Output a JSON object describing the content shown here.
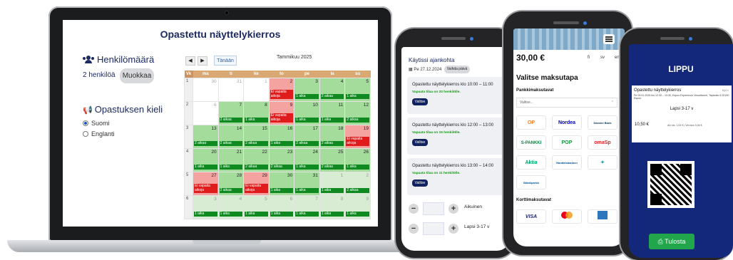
{
  "laptop": {
    "title": "Opastettu näyttelykierros",
    "persons_label": "Henkilömäärä",
    "persons_value": "2 henkilöä",
    "edit_button": "Muokkaa",
    "language_label": "Opastuksen kieli",
    "lang_fi": "Suomi",
    "lang_en": "Englanti",
    "nav_prev": "◀",
    "nav_next": "▶",
    "today_button": "Tänään",
    "month": "Tammikuu 2025",
    "weekdays": [
      "Vk",
      "ma",
      "ti",
      "ke",
      "to",
      "pe",
      "la",
      "su"
    ],
    "slot_ok": "1 aika",
    "slot_ok2": "2 aikaa",
    "slot_full": "Ei vapaita aikoja"
  },
  "calendar_rows": [
    {
      "week": "1",
      "days": [
        [
          "30",
          "w",
          ""
        ],
        [
          "31",
          "w",
          ""
        ],
        [
          "1",
          "w",
          ""
        ],
        [
          "2",
          "r",
          "full"
        ],
        [
          "3",
          "g",
          "1 aika"
        ],
        [
          "4",
          "g",
          "2 aikaa"
        ],
        [
          "5",
          "g",
          "1 aika"
        ]
      ]
    },
    {
      "week": "2",
      "days": [
        [
          "6",
          "w",
          ""
        ],
        [
          "7",
          "g",
          "2 aikaa"
        ],
        [
          "8",
          "g",
          "1 aika"
        ],
        [
          "9",
          "r",
          "full"
        ],
        [
          "10",
          "g",
          "1 aika"
        ],
        [
          "11",
          "g",
          "1 aika"
        ],
        [
          "12",
          "g",
          "2 aikaa"
        ]
      ]
    },
    {
      "week": "3",
      "days": [
        [
          "13",
          "g",
          "2 aikaa"
        ],
        [
          "14",
          "g",
          "2 aikaa"
        ],
        [
          "15",
          "g",
          "2 aikaa"
        ],
        [
          "16",
          "g",
          "1 aika"
        ],
        [
          "17",
          "g",
          "2 aikaa"
        ],
        [
          "18",
          "g",
          "2 aikaa"
        ],
        [
          "19",
          "r",
          "full"
        ]
      ]
    },
    {
      "week": "4",
      "days": [
        [
          "20",
          "g",
          "1 aika"
        ],
        [
          "21",
          "g",
          "1 aika"
        ],
        [
          "22",
          "g",
          "2 aikaa"
        ],
        [
          "23",
          "g",
          "2 aikaa"
        ],
        [
          "24",
          "g",
          "1 aika"
        ],
        [
          "25",
          "g",
          "2 aikaa"
        ],
        [
          "26",
          "g",
          "1 aika"
        ]
      ]
    },
    {
      "week": "5",
      "days": [
        [
          "27",
          "r",
          "full"
        ],
        [
          "28",
          "g",
          "2 aikaa"
        ],
        [
          "29",
          "r",
          "full"
        ],
        [
          "30",
          "g",
          "1 aika"
        ],
        [
          "31",
          "g",
          "1 aika"
        ],
        [
          "1",
          "pg",
          "1 aika"
        ],
        [
          "2",
          "pg",
          "2 aikaa"
        ]
      ]
    },
    {
      "week": "6",
      "days": [
        [
          "3",
          "pg",
          "1 aika"
        ],
        [
          "4",
          "pg",
          "1 aika"
        ],
        [
          "5",
          "pg",
          "1 aika"
        ],
        [
          "6",
          "pg",
          "1 aika"
        ],
        [
          "7",
          "pg",
          "1 aika"
        ],
        [
          "8",
          "pg",
          "1 aika"
        ],
        [
          "9",
          "pg",
          "1 aika"
        ]
      ]
    }
  ],
  "phone1": {
    "header": "Käytissi ajankohta",
    "date": "Pe 27.12.2024",
    "change": "Vaihda päivä",
    "cards": [
      {
        "title": "Opastettu näyttelykierros klo 10:00 – 11:00",
        "avail": "Vapaata tilaa on 20 henkilölle.",
        "btn": "Valitse"
      },
      {
        "title": "Opastettu näyttelykierros klo 12:00 – 13:00",
        "avail": "Vapaata tilaa on 15 henkilölle.",
        "btn": "Valitse"
      },
      {
        "title": "Opastettu näyttelykierros klo 13:00 – 14:00",
        "avail": "Vapaata tilaa on 11 henkilölle.",
        "btn": "Valitse"
      }
    ],
    "adult": "Aikuinen",
    "child": "Lapsi 3-17 v",
    "minus": "−",
    "plus": "+"
  },
  "phone2": {
    "price": "30,00 €",
    "lang_fi": "fi",
    "lang_sv": "sv",
    "lang_en": "en",
    "heading": "Valitse maksutapa",
    "bank_label": "Pankkimaksutavat",
    "select_placeholder": "Valitse...",
    "banks": [
      "OP",
      "Nordea",
      "Danske Bank",
      "S-PANKKI",
      "POP",
      "omaSp",
      "Aktia",
      "Handelsbanken",
      "Säästöpankki"
    ],
    "card_label": "Korttimaksutavat",
    "cards": [
      "VISA",
      "Mastercard",
      "Amex"
    ]
  },
  "phone3": {
    "title": "LIPPU",
    "ticket_name": "Opastettu näyttelykierros",
    "qty": "Kpl 1",
    "details": "Pe 09.01.2025 klo 12:30 – 13:30, Espoo Experience Visualisointi, Tapiontie 6 02150 Espoo",
    "category": "Lapsi 3-17 v",
    "price": "10,50 €",
    "vat": "Alv sis. 1,04 € | Veroton 9,46 €",
    "print": "Tulosta"
  },
  "colors": {
    "brand": "#1c2a64",
    "available": "#0f8a21",
    "full": "#e01b1b",
    "ticket_bg": "#13287a"
  }
}
